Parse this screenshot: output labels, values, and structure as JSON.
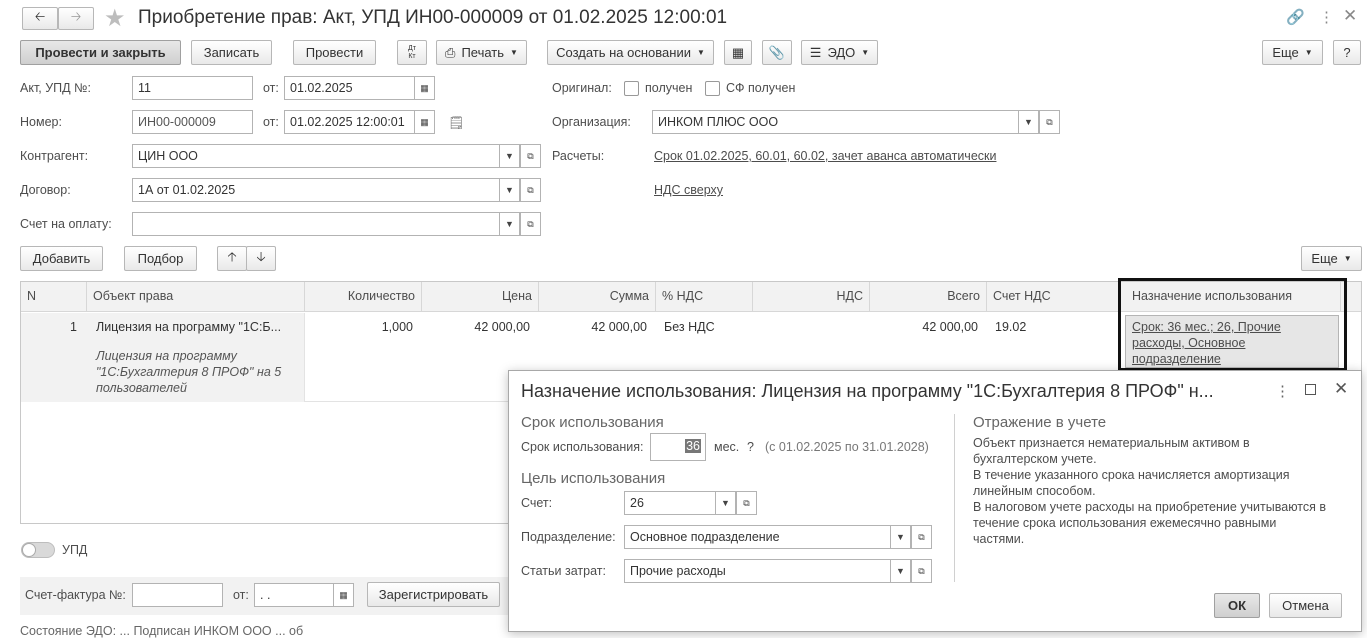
{
  "window": {
    "title": "Приобретение прав: Акт, УПД ИН00-000009 от 01.02.2025 12:00:01"
  },
  "toolbar": {
    "post_close": "Провести и закрыть",
    "save": "Записать",
    "post": "Провести",
    "dt_kt": "Дт\nКт",
    "print": "Печать",
    "create_based": "Создать на основании",
    "edo": "ЭДО",
    "more": "Еще",
    "help": "?"
  },
  "header": {
    "act_label": "Акт, УПД №:",
    "act_value": "11",
    "act_from_label": "от:",
    "act_date": "01.02.2025",
    "number_label": "Номер:",
    "number_value": "ИН00-000009",
    "number_from_label": "от:",
    "number_date": "01.02.2025 12:00:01",
    "counterparty_label": "Контрагент:",
    "counterparty_value": "ЦИН ООО",
    "contract_label": "Договор:",
    "contract_value": "1А от 01.02.2025",
    "invoice_label": "Счет на оплату:",
    "invoice_value": "",
    "original_label": "Оригинал:",
    "original_received": "получен",
    "sf_received": "СФ получен",
    "org_label": "Организация:",
    "org_value": "ИНКОМ ПЛЮС ООО",
    "settlements_label": "Расчеты:",
    "settlements_link": "Срок 01.02.2025, 60.01, 60.02, зачет аванса автоматически",
    "vat_link": "НДС сверху"
  },
  "table_toolbar": {
    "add": "Добавить",
    "pick": "Подбор",
    "more": "Еще"
  },
  "table": {
    "columns": [
      "N",
      "Объект права",
      "Количество",
      "Цена",
      "Сумма",
      "% НДС",
      "НДС",
      "Всего",
      "Счет НДС",
      "Назначение использования"
    ],
    "rows": [
      {
        "n": "1",
        "object": "Лицензия на программу \"1С:Б...",
        "object_full_1": "Лицензия на программу",
        "object_full_2": "\"1С:Бухгалтерия 8 ПРОФ\" на 5",
        "object_full_3": "пользователей",
        "qty": "1,000",
        "price": "42 000,00",
        "sum": "42 000,00",
        "vat_rate": "Без НДС",
        "vat": "",
        "total": "42 000,00",
        "vat_account": "19.02",
        "usage_1": "Срок: 36 мес.; 26, Прочие",
        "usage_2": "расходы, Основное",
        "usage_3": "подразделение"
      }
    ]
  },
  "footer": {
    "upd_label": "УПД",
    "sf_label": "Счет-фактура №:",
    "sf_value": "",
    "sf_from_label": "от:",
    "sf_date": " .  .",
    "register": "Зарегистрировать",
    "bottom_text": "Состояние ЭДО: ... Подписан ИНКОМ ООО ... об"
  },
  "popup": {
    "title": "Назначение использования: Лицензия на программу \"1С:Бухгалтерия 8 ПРОФ\" н...",
    "term_section": "Срок использования",
    "term_label": "Срок использования:",
    "term_value": "36",
    "term_unit": "мес.",
    "term_help": "?",
    "term_range": "(с 01.02.2025 по 31.01.2028)",
    "purpose_section": "Цель использования",
    "account_label": "Счет:",
    "account_value": "26",
    "dept_label": "Подразделение:",
    "dept_value": "Основное подразделение",
    "cost_label": "Статьи затрат:",
    "cost_value": "Прочие расходы",
    "reflection_section": "Отражение в учете",
    "reflection_1": "Объект признается нематериальным активом в",
    "reflection_2": "бухгалтерском учете.",
    "reflection_3": "В течение указанного срока начисляется амортизация",
    "reflection_4": "линейным способом.",
    "reflection_5": "В налоговом учете расходы на приобретение учитываются в",
    "reflection_6": "течение срока использования ежемесячно равными",
    "reflection_7": "частями.",
    "ok": "ОК",
    "cancel": "Отмена"
  }
}
